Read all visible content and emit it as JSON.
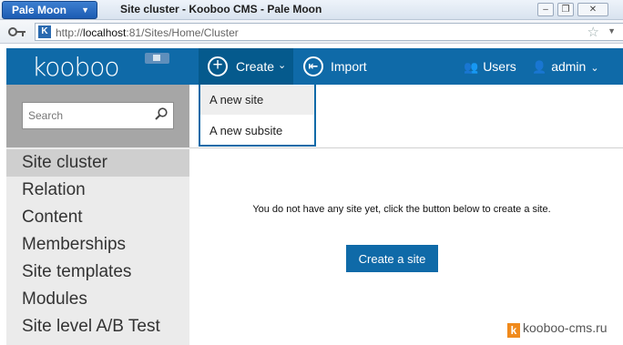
{
  "browser": {
    "app_button": "Pale Moon",
    "window_title": "Site cluster - Kooboo CMS - Pale Moon",
    "url_prefix": "http://",
    "url_host": "localhost",
    "url_rest": ":81/Sites/Home/Cluster"
  },
  "nav": {
    "logo": "kooboo",
    "create_label": "Create",
    "import_label": "Import",
    "users_label": "Users",
    "admin_label": "admin"
  },
  "create_menu": {
    "items": [
      "A new site",
      "A new subsite"
    ]
  },
  "search": {
    "placeholder": "Search"
  },
  "sidebar": {
    "items": [
      {
        "label": "Site cluster",
        "active": true
      },
      {
        "label": "Relation"
      },
      {
        "label": "Content"
      },
      {
        "label": "Memberships"
      },
      {
        "label": "Site templates"
      },
      {
        "label": "Modules"
      },
      {
        "label": "Site level A/B Test"
      }
    ]
  },
  "main": {
    "empty_message": "You do not have any site yet, click the button below to create a site.",
    "create_site_button": "Create a site"
  },
  "watermark": {
    "mark": "k",
    "text": "kooboo-cms.ru"
  },
  "colors": {
    "nav_blue": "#0f6aa8",
    "create_active": "#055a8d",
    "sidebar_bg": "#ebebeb",
    "sidebar_active": "#cfcfcf",
    "search_panel": "#a6a6a6",
    "watermark_orange": "#f08a1c"
  },
  "icons": [
    "key-icon",
    "favicon",
    "bookmark-star-icon",
    "home-icon",
    "plus-circle-icon",
    "import-icon",
    "users-icon",
    "user-icon",
    "search-icon"
  ]
}
